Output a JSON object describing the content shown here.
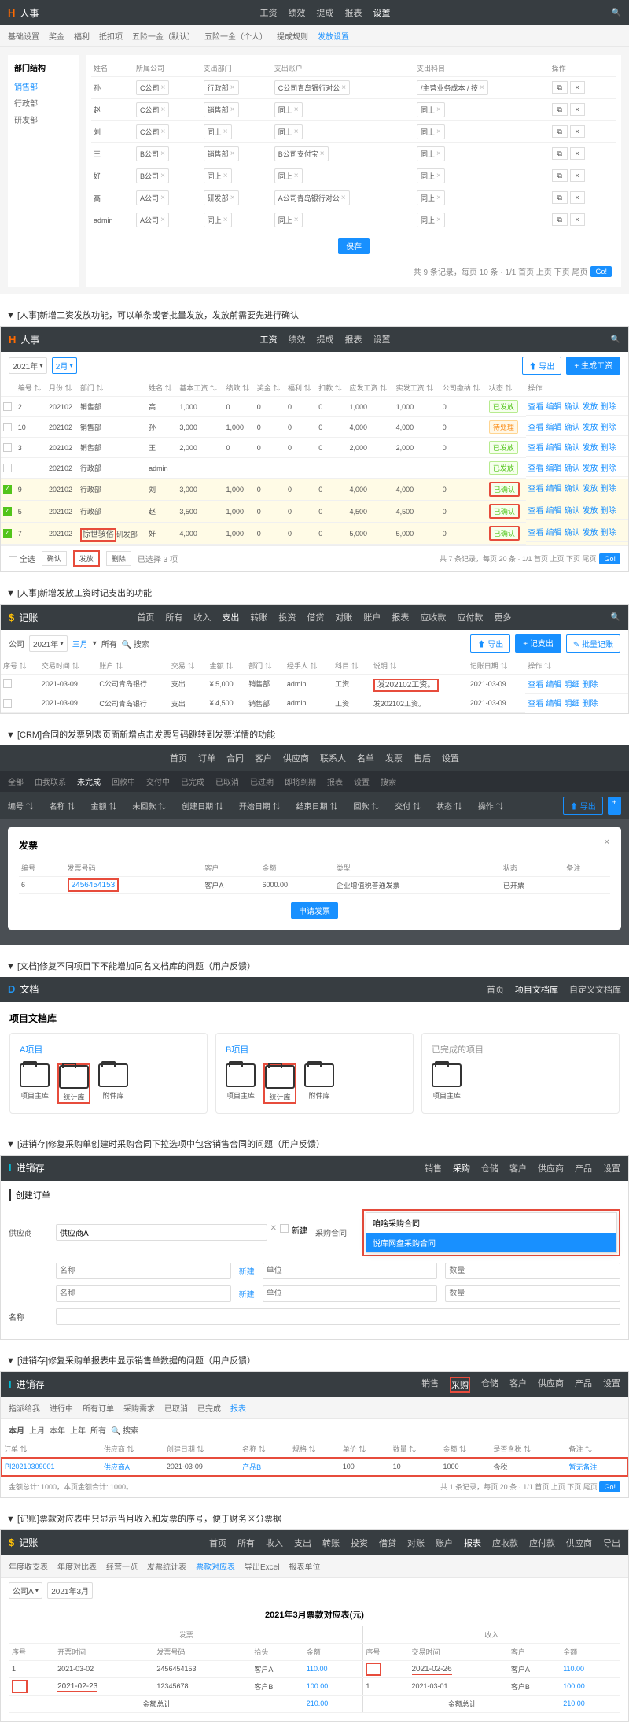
{
  "s1": {
    "nav": {
      "logo": "人事",
      "menu": [
        "工资",
        "绩效",
        "提成",
        "报表",
        "设置"
      ],
      "active": 4
    },
    "subnav": [
      "基础设置",
      "奖金",
      "福利",
      "抵扣项",
      "五险一金（默认）",
      "五险一金（个人）",
      "提成规则",
      "发放设置"
    ],
    "subnav_active": 7,
    "sidebar": {
      "title": "部门结构",
      "items": [
        "销售部",
        "行政部",
        "研发部"
      ]
    },
    "table": {
      "headers": [
        "姓名",
        "所属公司",
        "支出部门",
        "支出账户",
        "支出科目",
        "操作"
      ],
      "rows": [
        {
          "name": "孙",
          "company": "C公司",
          "dept": "行政部",
          "account": "C公司青岛银行对公",
          "subject": "/主营业务成本 / 技"
        },
        {
          "name": "赵",
          "company": "C公司",
          "dept": "销售部",
          "account": "同上",
          "subject": "同上"
        },
        {
          "name": "刘",
          "company": "C公司",
          "dept": "同上",
          "account": "同上",
          "subject": "同上"
        },
        {
          "name": "王",
          "company": "B公司",
          "dept": "销售部",
          "account": "B公司支付宝",
          "subject": "同上"
        },
        {
          "name": "好",
          "company": "B公司",
          "dept": "同上",
          "account": "同上",
          "subject": "同上"
        },
        {
          "name": "高",
          "company": "A公司",
          "dept": "研发部",
          "account": "A公司青岛银行对公",
          "subject": "同上"
        },
        {
          "name": "admin",
          "company": "A公司",
          "dept": "同上",
          "account": "同上",
          "subject": "同上"
        }
      ],
      "save": "保存",
      "footer": "共 9 条记录，每页 10 条 · 1/1   首页 上页 下页 尾页"
    }
  },
  "title1": "▼ [人事]新增工资发放功能，可以单条或者批量发放，发放前需要先进行确认",
  "s2": {
    "nav": {
      "logo": "人事",
      "menu": [
        "工资",
        "绩效",
        "提成",
        "报表",
        "设置"
      ],
      "active": 0
    },
    "toolbar": {
      "year": "2021年",
      "month": "2月",
      "export": "导出",
      "generate": "生成工资"
    },
    "headers": [
      "",
      "编号",
      "月份",
      "部门",
      "姓名",
      "基本工资",
      "绩效",
      "奖金",
      "福利",
      "扣款",
      "应发工资",
      "实发工资",
      "公司缴纳",
      "状态",
      "操作"
    ],
    "rows": [
      {
        "chk": false,
        "id": "2",
        "month": "202102",
        "dept": "销售部",
        "name": "高",
        "base": "1,000",
        "perf": "0",
        "bonus": "0",
        "welfare": "0",
        "deduct": "0",
        "due": "1,000",
        "actual": "1,000",
        "company": "0",
        "status": "已发放",
        "status_cls": "green",
        "actions": "查看 编辑 确认 发放 删除"
      },
      {
        "chk": false,
        "id": "10",
        "month": "202102",
        "dept": "销售部",
        "name": "孙",
        "base": "3,000",
        "perf": "1,000",
        "bonus": "0",
        "welfare": "0",
        "deduct": "0",
        "due": "4,000",
        "actual": "4,000",
        "company": "0",
        "status": "待处理",
        "status_cls": "orange",
        "actions": "查看 编辑 确认 发放 删除"
      },
      {
        "chk": false,
        "id": "3",
        "month": "202102",
        "dept": "销售部",
        "name": "王",
        "base": "2,000",
        "perf": "0",
        "bonus": "0",
        "welfare": "0",
        "deduct": "0",
        "due": "2,000",
        "actual": "2,000",
        "company": "0",
        "status": "已发放",
        "status_cls": "green",
        "actions": "查看 编辑 确认 发放 删除"
      },
      {
        "chk": false,
        "id": "",
        "month": "202102",
        "dept": "行政部",
        "name": "admin",
        "base": "",
        "perf": "",
        "bonus": "",
        "welfare": "",
        "deduct": "",
        "due": "",
        "actual": "",
        "company": "",
        "status": "已发放",
        "status_cls": "green",
        "actions": "查看 编辑 确认 发放 删除"
      },
      {
        "chk": true,
        "id": "9",
        "month": "202102",
        "dept": "行政部",
        "name": "刘",
        "base": "3,000",
        "perf": "1,000",
        "bonus": "0",
        "welfare": "0",
        "deduct": "0",
        "due": "4,000",
        "actual": "4,000",
        "company": "0",
        "status": "已确认",
        "status_cls": "green",
        "actions": "查看 编辑 确认 发放 删除",
        "yellow": true
      },
      {
        "chk": true,
        "id": "5",
        "month": "202102",
        "dept": "行政部",
        "name": "赵",
        "base": "3,500",
        "perf": "1,000",
        "bonus": "0",
        "welfare": "0",
        "deduct": "0",
        "due": "4,500",
        "actual": "4,500",
        "company": "0",
        "status": "已确认",
        "status_cls": "green",
        "actions": "查看 编辑 确认 发放 删除",
        "yellow": true
      },
      {
        "chk": true,
        "id": "7",
        "month": "202102",
        "dept": "研发部",
        "name": "好",
        "base": "4,000",
        "perf": "1,000",
        "bonus": "0",
        "welfare": "0",
        "deduct": "0",
        "due": "5,000",
        "actual": "5,000",
        "company": "0",
        "status": "已确认",
        "status_cls": "green",
        "actions": "查看 编辑 确认 发放 删除",
        "yellow": true,
        "dept_red": true,
        "dept_text": "惊世骇俗"
      }
    ],
    "footer_left": [
      "全选",
      "确认",
      "发放",
      "删除",
      "已选择 3 项"
    ],
    "footer_right": "共 7 条记录，每页 20 条 · 1/1   首页 上页 下页 尾页"
  },
  "title2": "▼ [人事]新增发放工资时记支出的功能",
  "s3": {
    "nav": {
      "logo": "记账",
      "menu": [
        "首页",
        "所有",
        "收入",
        "支出",
        "转账",
        "投资",
        "借贷",
        "对账",
        "账户",
        "报表",
        "应收款",
        "应付款",
        "更多"
      ],
      "active": 3
    },
    "toolbar": {
      "company": "公司",
      "year": "2021年",
      "month": "三月",
      "all": "所有",
      "search": "搜索",
      "export": "导出",
      "add": "+ 记支出",
      "batch": "批量记账"
    },
    "headers": [
      "序号",
      "交易时间",
      "账户",
      "交易",
      "金额",
      "部门",
      "经手人",
      "科目",
      "说明",
      "记账日期",
      "操作"
    ],
    "rows": [
      {
        "id": "",
        "date": "2021-03-09",
        "account": "C公司青岛银行",
        "type": "支出",
        "amount": "¥ 5,000",
        "dept": "销售部",
        "person": "admin",
        "subject": "工资",
        "note": "发202102工资。",
        "recdate": "2021-03-09",
        "actions": "查看 编辑 明细 删除"
      },
      {
        "id": "",
        "date": "2021-03-09",
        "account": "C公司青岛银行",
        "type": "支出",
        "amount": "¥ 4,500",
        "dept": "销售部",
        "person": "admin",
        "subject": "工资",
        "note": "发202102工资。",
        "recdate": "2021-03-09",
        "actions": "查看 编辑 明细 删除"
      }
    ]
  },
  "title3": "▼ [CRM]合同的发票列表页面新增点击发票号码跳转到发票详情的功能",
  "s4": {
    "nav": [
      "首页",
      "订单",
      "合同",
      "客户",
      "供应商",
      "联系人",
      "名单",
      "发票",
      "售后",
      "设置"
    ],
    "subnav": [
      "全部",
      "由我联系",
      "未完成",
      "回款中",
      "交付中",
      "已完成",
      "已取消",
      "已过期",
      "即将到期",
      "报表",
      "设置",
      "搜索"
    ],
    "subnav_active": 2,
    "toolbar": {
      "export": "导出",
      "add": "+"
    },
    "headers": [
      "编号",
      "名称",
      "金额",
      "未回款",
      "创建日期",
      "开始日期",
      "结束日期",
      "回款",
      "交付",
      "状态",
      "操作"
    ],
    "invoice": {
      "title": "发票",
      "tbl_headers": [
        "编号",
        "发票号码",
        "客户",
        "金额",
        "类型",
        "状态",
        "备注"
      ],
      "row": {
        "id": "6",
        "number": "2456454153",
        "customer": "客户A",
        "amount": "6000.00",
        "type": "企业增值税普通发票",
        "status": "已开票",
        "remark": ""
      },
      "apply": "申请发票"
    }
  },
  "title4": "▼ [文档]修复不同项目下不能增加同名文档库的问题（用户反馈）",
  "s5": {
    "nav": {
      "logo": "文档",
      "menu": [
        "首页",
        "项目文档库",
        "自定义文档库"
      ],
      "active": 1
    },
    "title": "项目文档库",
    "cards": [
      {
        "title": "A项目",
        "folders": [
          "项目主库",
          "统计库",
          "附件库"
        ],
        "red": 1
      },
      {
        "title": "B项目",
        "folders": [
          "项目主库",
          "统计库",
          "附件库"
        ],
        "red": 1
      },
      {
        "title": "已完成的项目",
        "gray": true,
        "folders": [
          "项目主库"
        ]
      }
    ]
  },
  "title5": "▼ [进销存]修复采购单创建时采购合同下拉选项中包含销售合同的问题（用户反馈）",
  "s6": {
    "nav": {
      "logo": "进销存",
      "menu": [
        "销售",
        "采购",
        "仓储",
        "客户",
        "供应商",
        "产品",
        "设置"
      ],
      "active": 1
    },
    "form_title": "创建订单",
    "supplier_label": "供应商",
    "supplier_val": "供应商A",
    "new_sup": "新建",
    "contract_label": "采购合同",
    "opts": [
      "咱啥采购合同",
      "悦库网盘采购合同"
    ],
    "name_label": "名称",
    "name_ph": "名称",
    "add": "新建",
    "unit": "单位",
    "qty": "数量"
  },
  "title6": "▼ [进销存]修复采购单报表中显示销售单数据的问题（用户反馈）",
  "s7": {
    "nav": {
      "logo": "进销存",
      "menu": [
        "销售",
        "采购",
        "仓储",
        "客户",
        "供应商",
        "产品",
        "设置"
      ],
      "active": 1
    },
    "subnav": [
      "指派给我",
      "进行中",
      "所有订单",
      "采购需求",
      "已取消",
      "已完成",
      "报表"
    ],
    "subnav_active": 6,
    "tabs": [
      "本月",
      "上月",
      "本年",
      "上年",
      "所有",
      "搜索"
    ],
    "headers": [
      "订单",
      "供应商",
      "创建日期",
      "名称",
      "规格",
      "单价",
      "数量",
      "金额",
      "是否含税",
      "备注"
    ],
    "row": {
      "order": "PI20210309001",
      "supplier": "供应商A",
      "date": "2021-03-09",
      "name": "产品B",
      "spec": "",
      "price": "100",
      "qty": "10",
      "amount": "1000",
      "tax": "含税",
      "remark": "暂无备注"
    },
    "footer_left": "金额总计: 1000，本页金额合计: 1000。",
    "footer_right": "共 1 条记录，每页 20 条 · 1/1   首页 上页 下页 尾页"
  },
  "title7": "▼ [记账]票款对应表中只显示当月收入和发票的序号，便于财务区分票据",
  "s8": {
    "nav": {
      "logo": "记账",
      "menu": [
        "首页",
        "所有",
        "收入",
        "支出",
        "转账",
        "投资",
        "借贷",
        "对账",
        "账户",
        "报表",
        "应收款",
        "应付款",
        "供应商",
        "导出"
      ],
      "active": 9
    },
    "subnav": [
      "年度收支表",
      "年度对比表",
      "经营一览",
      "发票统计表",
      "票款对应表",
      "导出Excel",
      "报表单位"
    ],
    "subnav_active": 4,
    "filter": {
      "company": "公司A",
      "month": "2021年3月"
    },
    "title": "2021年3月票款对应表(元)",
    "grp1": "发票",
    "grp2": "收入",
    "headers1": [
      "序号",
      "开票时间",
      "发票号码",
      "抬头",
      "金额"
    ],
    "headers2": [
      "序号",
      "交易时间",
      "客户",
      "金额"
    ],
    "rows": [
      {
        "l": {
          "id": "1",
          "date": "2021-03-02",
          "num": "2456454153",
          "head": "客户A",
          "amt": "110.00"
        },
        "r": {
          "id": "",
          "date": "2021-02-26",
          "cust": "客户A",
          "amt": "110.00"
        }
      },
      {
        "l": {
          "id": "",
          "date": "2021-02-23",
          "num": "12345678",
          "head": "客户B",
          "amt": "100.00"
        },
        "r": {
          "id": "1",
          "date": "2021-03-01",
          "cust": "客户B",
          "amt": "100.00"
        }
      }
    ],
    "total_label": "金额总计",
    "total1": "210.00",
    "total2": "210.00"
  }
}
